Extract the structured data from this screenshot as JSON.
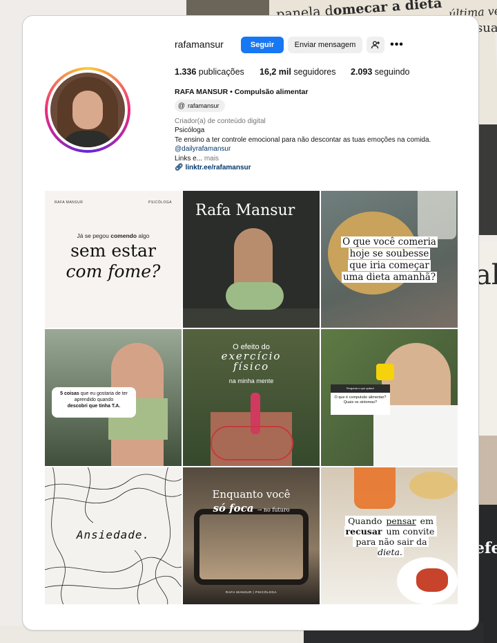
{
  "profile": {
    "username": "rafamansur",
    "follow_label": "Seguir",
    "message_label": "Enviar mensagem",
    "stats": {
      "posts_count": "1.336",
      "posts_label": "publicações",
      "followers_count": "16,2 mil",
      "followers_label": "seguidores",
      "following_count": "2.093",
      "following_label": "seguindo"
    },
    "full_name": "RAFA MANSUR • Compulsão alimentar",
    "threads_handle": "rafamansur",
    "category": "Criador(a) de conteúdo digital",
    "bio_line1": "Psicóloga",
    "bio_line2": "Te ensino a ter controle emocional para não descontar as tuas emoções na comida.",
    "mention": "@dailyrafamansur",
    "links_text": "Links e...",
    "more_label": "mais",
    "link_url": "linktr.ee/rafamansur"
  },
  "posts": {
    "p1": {
      "brand": "RAFA MANSUR",
      "role": "PSICÓLOGA",
      "small": "Já se pegou",
      "small_bold": "comendo",
      "small_end": "algo",
      "big1": "sem estar",
      "big2": "com fome?"
    },
    "p2": {
      "title": "Rafa Mansur"
    },
    "p3": {
      "line1": "O que você comeria",
      "line2": "hoje se soubesse",
      "line3": "que iria começar",
      "line4": "uma dieta amanhã?"
    },
    "p4": {
      "num": "5 coisas",
      "rest": "que eu gostaria de ter aprendido quando",
      "bold": "descobri que tinha T.A."
    },
    "p5": {
      "line1": "O efeito do",
      "line2": "exercício",
      "line3": "físico",
      "line4": "na minha mente"
    },
    "p6": {
      "q1": "Pergunta o que quiser!",
      "q2": "O que é compulsão alimentar? Quais os sintomas?"
    },
    "p7": {
      "word": "Ansiedade."
    },
    "p8": {
      "line1": "Enquanto você",
      "line2": "só foca",
      "line2_small": "→ no futuro",
      "footer": "RAFA MANSUR | PSICÓLOGA"
    },
    "p9": {
      "line1a": "Quando",
      "line1b": "pensar",
      "line1c": "em",
      "line2a": "recusar",
      "line2b": "um convite",
      "line3a": "para não sair da",
      "line3b": "dieta."
    }
  },
  "collage": {
    "text1a": "panela d",
    "text1b": "omecar a dieta",
    "text2": "última vez",
    "text3": "sua",
    "text4": "ab",
    "text5": "efe"
  },
  "icons": {
    "add_user": "add-user-icon",
    "more": "more-icon",
    "threads": "threads-icon",
    "link": "link-icon"
  }
}
